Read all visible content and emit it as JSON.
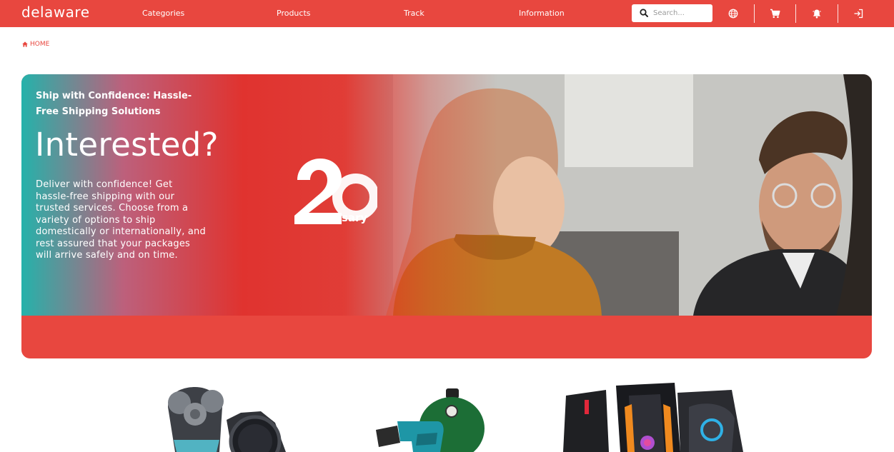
{
  "brand": {
    "logo_text": "delaware"
  },
  "nav": {
    "items": [
      {
        "label": "Categories"
      },
      {
        "label": "Products"
      },
      {
        "label": "Track"
      },
      {
        "label": "Information"
      }
    ]
  },
  "search": {
    "placeholder": "Search..."
  },
  "toolbar_icons": [
    "globe-icon",
    "cart-icon",
    "notification-bell-icon",
    "login-icon"
  ],
  "breadcrumb": {
    "home_label": "HOME"
  },
  "hero": {
    "eyebrow": "Ship with Confidence: Hassle-Free Shipping Solutions",
    "title": "Interested?",
    "body": "Deliver with confidence! Get hassle-free shipping with our trusted services. Choose from a variety of options to ship domestically or internationally, and rest assured that your packages will arrive safely and on time.",
    "badge_caption": "anniversary"
  },
  "products": [
    {
      "icon": "shaver-and-smartwatch-image"
    },
    {
      "icon": "drill-and-grill-image"
    },
    {
      "icon": "gaming-pc-towers-image"
    }
  ],
  "colors": {
    "brand": "#e8473f",
    "accent_teal": "#20b2aa"
  }
}
